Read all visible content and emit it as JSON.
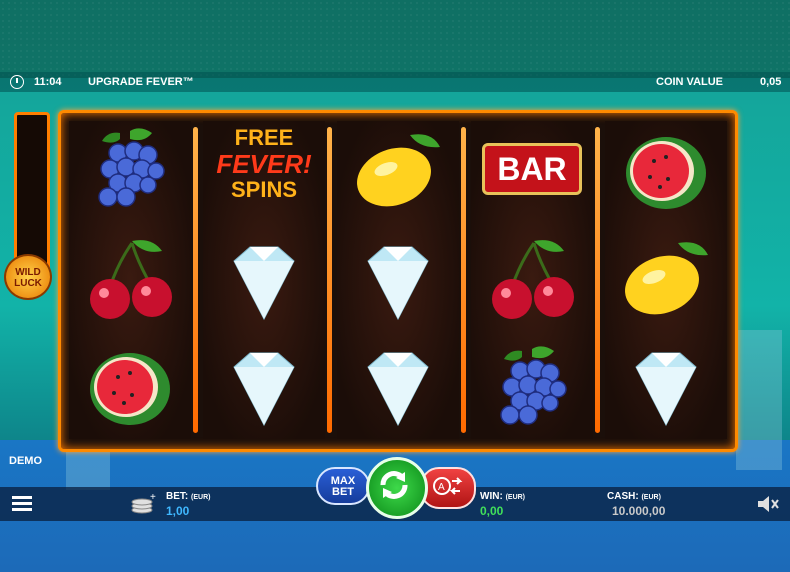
{
  "topbar": {
    "time": "11:04",
    "game_title": "UPGRADE FEVER™",
    "coin_value_label": "COIN VALUE",
    "coin_value": "0,05"
  },
  "reels": [
    [
      "grapes",
      "cherries",
      "watermelon"
    ],
    [
      "free-fever-spins",
      "diamond",
      "diamond"
    ],
    [
      "lemon",
      "diamond",
      "diamond"
    ],
    [
      "bar",
      "cherries",
      "grapes"
    ],
    [
      "watermelon",
      "lemon",
      "diamond"
    ]
  ],
  "symbols": {
    "free_line1": "FREE",
    "free_line2": "FEVER!",
    "free_line3": "SPINS",
    "bar": "BAR"
  },
  "wild_luck": {
    "line1": "WILD",
    "line2": "LUCK"
  },
  "demo_label": "DEMO",
  "bottom": {
    "bet_label": "BET:",
    "bet_currency": "(EUR)",
    "bet_value": "1,00",
    "win_label": "WIN:",
    "win_currency": "(EUR)",
    "win_value": "0,00",
    "cash_label": "CASH:",
    "cash_currency": "(EUR)",
    "cash_value": "10.000,00",
    "max_bet_line1": "MAX",
    "max_bet_line2": "BET"
  },
  "colors": {
    "frame": "#ff8a00",
    "value_blue": "#3fb8ff",
    "value_green": "#41e05a",
    "value_gray": "#c9c9c9"
  }
}
